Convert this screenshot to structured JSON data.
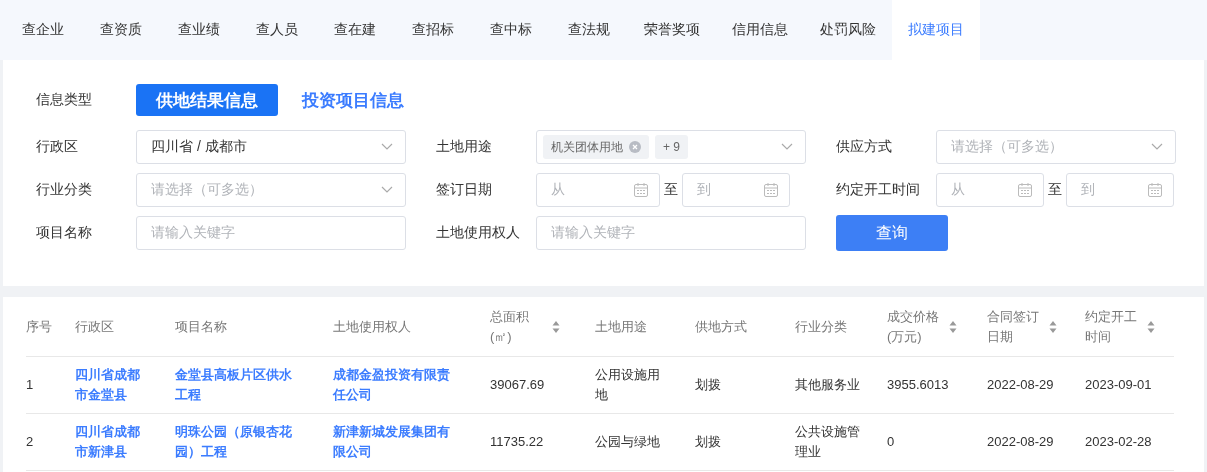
{
  "nav_tabs": [
    {
      "label": "查企业",
      "selected": false
    },
    {
      "label": "查资质",
      "selected": false
    },
    {
      "label": "查业绩",
      "selected": false
    },
    {
      "label": "查人员",
      "selected": false
    },
    {
      "label": "查在建",
      "selected": false
    },
    {
      "label": "查招标",
      "selected": false
    },
    {
      "label": "查中标",
      "selected": false
    },
    {
      "label": "查法规",
      "selected": false
    },
    {
      "label": "荣誉奖项",
      "selected": false
    },
    {
      "label": "信用信息",
      "selected": false
    },
    {
      "label": "处罚风险",
      "selected": false
    },
    {
      "label": "拟建项目",
      "selected": true
    }
  ],
  "info_type": {
    "label": "信息类型",
    "options": [
      {
        "label": "供地结果信息",
        "selected": true
      },
      {
        "label": "投资项目信息",
        "selected": false
      }
    ]
  },
  "filters": [
    {
      "kind": "select",
      "label": "行政区",
      "value": "四川省 / 成都市"
    },
    {
      "kind": "tags",
      "label": "土地用途",
      "tags": [
        {
          "kind": "removable",
          "label": "机关团体用地"
        },
        {
          "kind": "count",
          "label": "+ 9"
        }
      ]
    },
    {
      "kind": "select",
      "label": "供应方式",
      "placeholder": "请选择（可多选）"
    },
    {
      "kind": "select",
      "label": "行业分类",
      "placeholder": "请选择（可多选）"
    },
    {
      "kind": "daterange",
      "label": "签订日期",
      "from_placeholder": "从",
      "separator": "至",
      "to_placeholder": "到"
    },
    {
      "kind": "daterange",
      "label": "约定开工时间",
      "from_placeholder": "从",
      "separator": "至",
      "to_placeholder": "到"
    },
    {
      "kind": "input",
      "label": "项目名称",
      "placeholder": "请输入关键字"
    },
    {
      "kind": "input",
      "label": "土地使用权人",
      "placeholder": "请输入关键字"
    },
    {
      "kind": "button",
      "label": "查询"
    }
  ],
  "table": {
    "columns": [
      {
        "label": "序号",
        "sortable": false
      },
      {
        "label": "行政区",
        "sortable": false
      },
      {
        "label": "项目名称",
        "sortable": false
      },
      {
        "label": "土地使用权人",
        "sortable": false
      },
      {
        "label": "总面积(㎡)",
        "sortable": true
      },
      {
        "label": "土地用途",
        "sortable": false
      },
      {
        "label": "供地方式",
        "sortable": false
      },
      {
        "label": "行业分类",
        "sortable": false
      },
      {
        "label": "成交价格(万元)",
        "sortable": true
      },
      {
        "label": "合同签订日期",
        "sortable": true
      },
      {
        "label": "约定开工时间",
        "sortable": true
      }
    ],
    "rows": [
      [
        "1",
        "四川省成都市金堂县",
        "金堂县高板片区供水工程",
        "成都金盈投资有限责任公司",
        "39067.69",
        "公用设施用地",
        "划拨",
        "其他服务业",
        "3955.6013",
        "2022-08-29",
        "2023-09-01"
      ],
      [
        "2",
        "四川省成都市新津县",
        "明珠公园（原银杏花园）工程",
        "新津新城发展集团有限公司",
        "11735.22",
        "公园与绿地",
        "划拨",
        "公共设施管理业",
        "0",
        "2022-08-29",
        "2023-02-28"
      ]
    ]
  }
}
